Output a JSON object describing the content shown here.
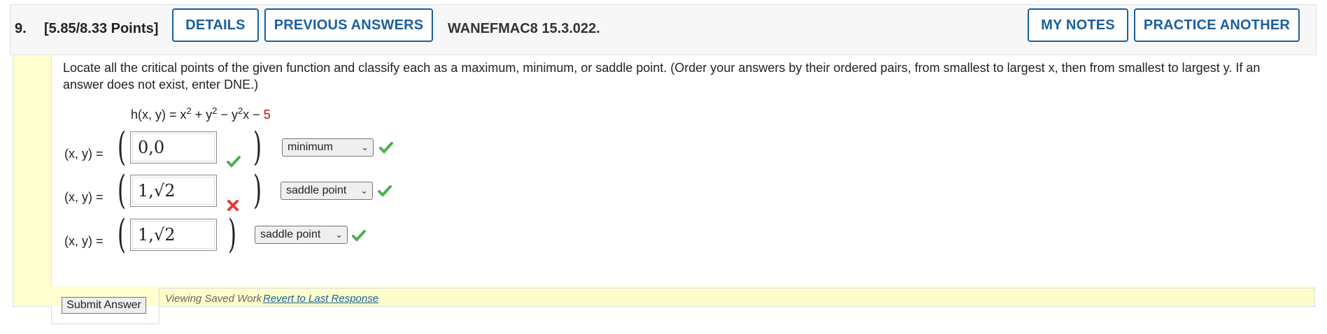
{
  "header": {
    "number": "9.",
    "points": "[5.85/8.33 Points]",
    "details_label": "DETAILS",
    "previous_answers_label": "PREVIOUS ANSWERS",
    "source": "WANEFMAC8 15.3.022.",
    "my_notes_label": "MY NOTES",
    "practice_another_label": "PRACTICE ANOTHER"
  },
  "question": {
    "prompt": "Locate all the critical points of the given function and classify each as a maximum, minimum, or saddle point. (Order your answers by their ordered pairs, from smallest to largest x, then from smallest to largest y. If an answer does not exist, enter DNE.)",
    "function_lhs": "h(x, y) = x",
    "function_mid1": " + y",
    "function_mid2": " − y",
    "function_mid3": "x − ",
    "function_const": "5",
    "exp": "2"
  },
  "answers": [
    {
      "label": "(x, y)  =",
      "value": "0,0",
      "status": "correct",
      "selected": "minimum",
      "select_status": "correct"
    },
    {
      "label": "(x, y)  =",
      "value": "1,√2",
      "status": "incorrect",
      "selected": "saddle point",
      "select_status": "correct"
    },
    {
      "label": "(x, y)  =",
      "value": "1,√2",
      "status": "none",
      "selected": "saddle point",
      "select_status": "correct"
    }
  ],
  "footer": {
    "submit_label": "Submit Answer",
    "saved_text": "Viewing Saved Work",
    "revert_label": "Revert to Last Response"
  },
  "colors": {
    "brand_blue": "#1a5f9c",
    "correct_green": "#4caf50",
    "incorrect_red": "#e53935",
    "highlight_yellow": "#fefecf"
  },
  "icons": {
    "correct": "check-icon",
    "incorrect": "x-mark-icon",
    "dropdown": "chevron-down-icon"
  }
}
